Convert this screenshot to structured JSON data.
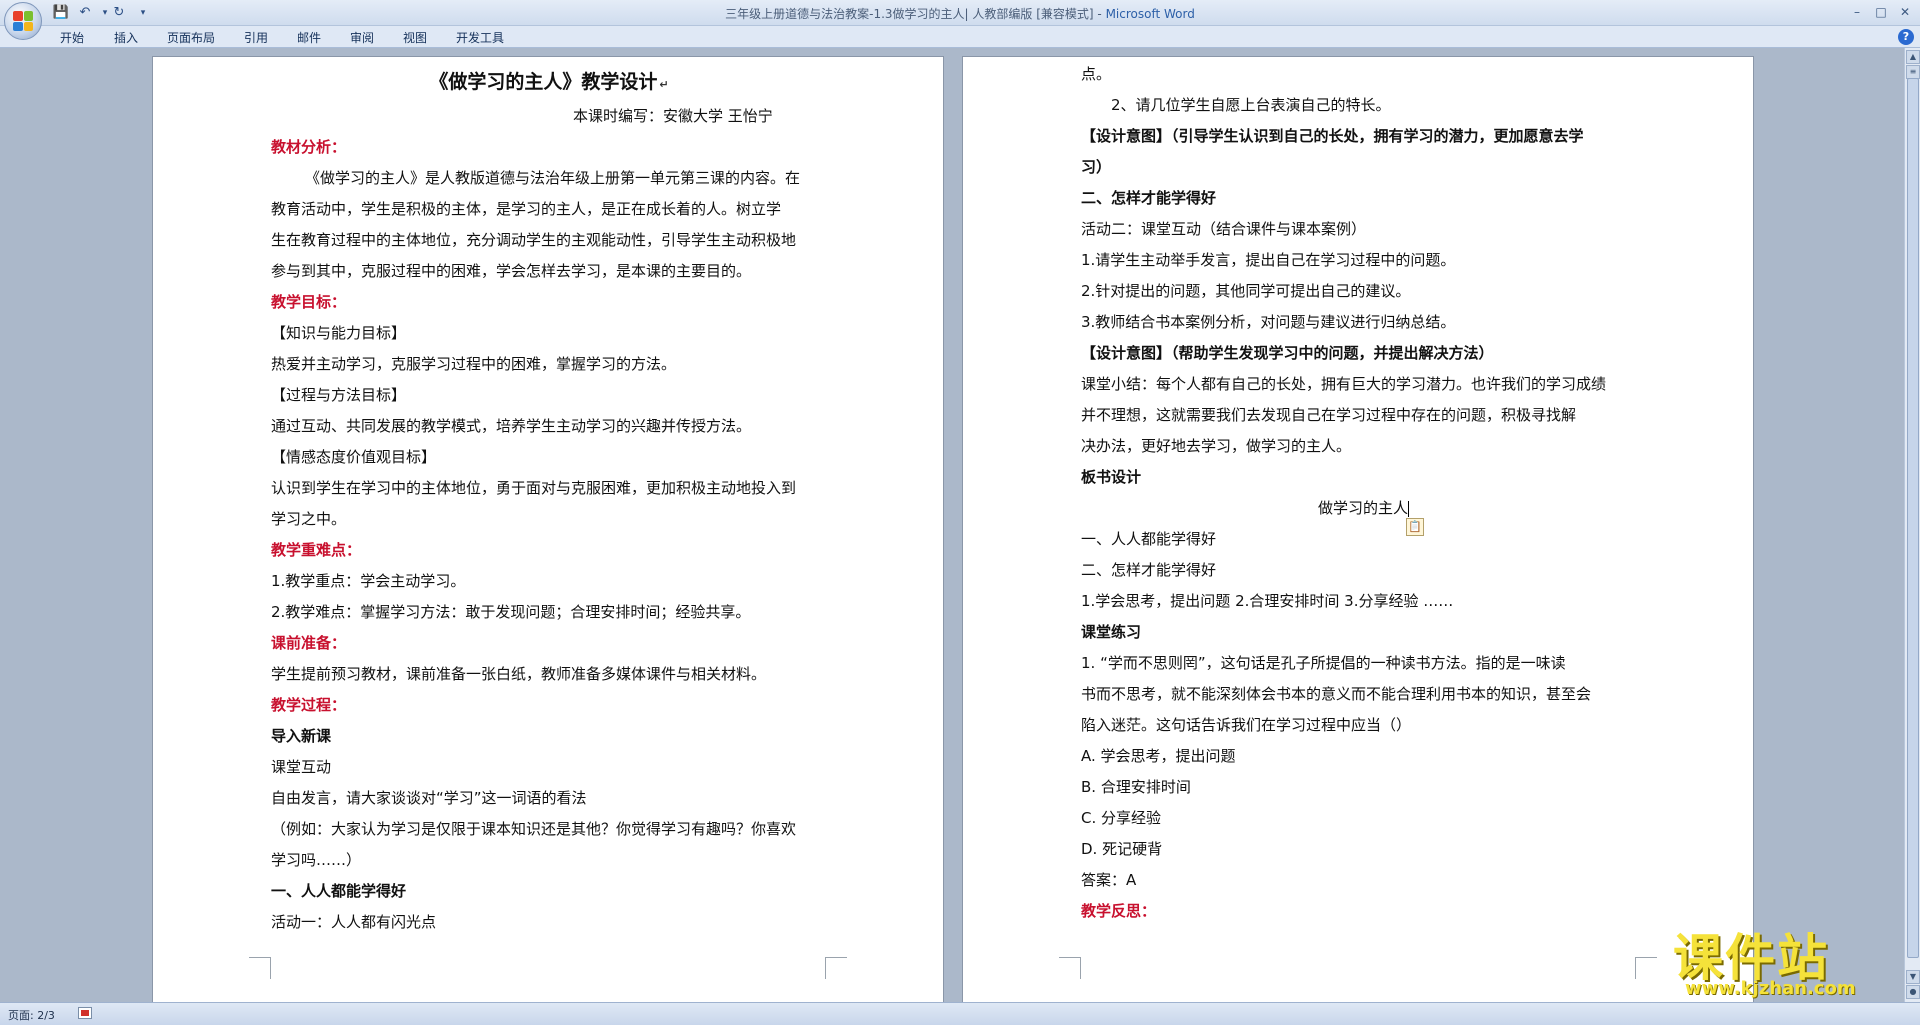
{
  "window": {
    "title": "三年级上册道德与法治教案-1.3做学习的主人| 人教部编版 [兼容模式] - ",
    "app_name": "Microsoft Word"
  },
  "ribbon": {
    "tabs": [
      "开始",
      "插入",
      "页面布局",
      "引用",
      "邮件",
      "审阅",
      "视图",
      "开发工具"
    ]
  },
  "left_page": {
    "title": "《做学习的主人》教学设计",
    "author": "本课时编写：安徽大学    王怡宁",
    "analysis_heading": "教材分析：",
    "analysis_p1": "《做学习的主人》是人教版道德与法治年级上册第一单元第三课的内容。在",
    "analysis_p2": "教育活动中，学生是积极的主体，是学习的主人，是正在成长着的人。树立学",
    "analysis_p3": "生在教育过程中的主体地位，充分调动学生的主观能动性，引导学生主动积极地",
    "analysis_p4": "参与到其中，克服过程中的困难，学会怎样去学习，是本课的主要目的。",
    "goals_heading": "教学目标：",
    "goal1_label": "【知识与能力目标】",
    "goal1_text": "热爱并主动学习，克服学习过程中的困难，掌握学习的方法。",
    "goal2_label": "【过程与方法目标】",
    "goal2_text": "通过互动、共同发展的教学模式，培养学生主动学习的兴趣并传授方法。",
    "goal3_label": "【情感态度价值观目标】",
    "goal3_text1": "认识到学生在学习中的主体地位，勇于面对与克服困难，更加积极主动地投入到",
    "goal3_text2": "学习之中。",
    "key_heading": "教学重难点：",
    "key1": "1.教学重点：学会主动学习。",
    "key2": "2.教学难点：掌握学习方法：敢于发现问题；合理安排时间；经验共享。",
    "prep_heading": "课前准备：",
    "prep_text": "学生提前预习教材，课前准备一张白纸，教师准备多媒体课件与相关材料。",
    "process_heading": "教学过程：",
    "intro_heading": "导入新课",
    "interaction": "课堂互动",
    "speak": "自由发言，请大家谈谈对“学习”这一词语的看法",
    "example1": "（例如：大家认为学习是仅限于课本知识还是其他？你觉得学习有趣吗？你喜欢",
    "example2": "学习吗……）",
    "section1": "一、人人都能学得好",
    "activity1": "活动一：人人都有闪光点"
  },
  "right_page": {
    "l1": "点。",
    "l2": "2、请几位学生自愿上台表演自己的特长。",
    "intent1a": "【设计意图】（引导学生认识到自己的长处，拥有学习的潜力，更加愿意去学",
    "intent1b": "习）",
    "section2": "二、怎样才能学得好",
    "activity2": "活动二：课堂互动（结合课件与课本案例）",
    "a2_1": "1.请学生主动举手发言，提出自己在学习过程中的问题。",
    "a2_2": "2.针对提出的问题，其他同学可提出自己的建议。",
    "a2_3": "3.教师结合书本案例分析，对问题与建议进行归纳总结。",
    "intent2": "【设计意图】（帮助学生发现学习中的问题，并提出解决方法）",
    "summary1": "课堂小结：每个人都有自己的长处，拥有巨大的学习潜力。也许我们的学习成绩",
    "summary2": "并不理想，这就需要我们去发现自己在学习过程中存在的问题，积极寻找解",
    "summary3": "决办法，更好地去学习，做学习的主人。",
    "board_heading": "板书设计",
    "board_title": "做学习的主人",
    "board1": "一、人人都能学得好",
    "board2": "二、怎样才能学得好",
    "board3": "1.学会思考，提出问题    2.合理安排时间    3.分享经验 ……",
    "practice_heading": "课堂练习",
    "q1a": "1. “学而不思则罔”，这句话是孔子所提倡的一种读书方法。指的是一味读",
    "q1b": "书而不思考，就不能深刻体会书本的意义而不能合理利用书本的知识，甚至会",
    "q1c": "陷入迷茫。这句话告诉我们在学习过程中应当（）",
    "optA": "A.  学会思考，提出问题",
    "optB": "B.  合理安排时间",
    "optC": "C.  分享经验",
    "optD": "D.  死记硬背",
    "answer": "答案：A",
    "reflection_heading": "教学反思："
  },
  "status": {
    "page_info": "页面: 2/3"
  },
  "watermark": {
    "main": "课件站",
    "url": "www.kjzhan.com"
  },
  "colors": {
    "heading_red": "#c8102e",
    "ribbon_bg": "#dfe8f5",
    "doc_bg": "#abb8ca"
  }
}
